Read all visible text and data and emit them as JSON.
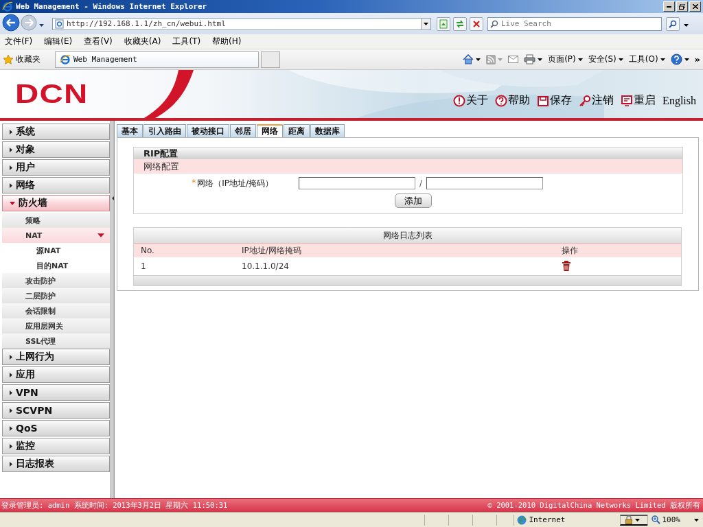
{
  "browser": {
    "title": "Web Management - Windows Internet Explorer",
    "address": "http://192.168.1.1/zh_cn/webui.html",
    "search_placeholder": "Live Search",
    "menu": [
      "文件(F)",
      "编辑(E)",
      "查看(V)",
      "收藏夹(A)",
      "工具(T)",
      "帮助(H)"
    ],
    "favorites_label": "收藏夹",
    "tab_title": "Web Management",
    "commands": [
      {
        "kind": "home"
      },
      {
        "kind": "feed"
      },
      {
        "kind": "mail"
      },
      {
        "kind": "print"
      },
      {
        "kind": "text",
        "label": "页面(P)"
      },
      {
        "kind": "text",
        "label": "安全(S)"
      },
      {
        "kind": "text",
        "label": "工具(O)"
      },
      {
        "kind": "help"
      }
    ],
    "overflow": "»"
  },
  "header": {
    "logo": "DCN",
    "links": [
      {
        "kind": "info",
        "label": "关于"
      },
      {
        "kind": "help",
        "label": "帮助"
      },
      {
        "kind": "save",
        "label": "保存"
      },
      {
        "kind": "logout",
        "label": "注销"
      },
      {
        "kind": "restart",
        "label": "重启"
      },
      {
        "kind": "text",
        "label": "English"
      }
    ]
  },
  "sidebar": {
    "items": [
      {
        "label": "系统",
        "expanded": false
      },
      {
        "label": "对象",
        "expanded": false
      },
      {
        "label": "用户",
        "expanded": false
      },
      {
        "label": "网络",
        "expanded": false
      },
      {
        "label": "防火墙",
        "expanded": true,
        "children": [
          {
            "label": "策略",
            "selected": false
          },
          {
            "label": "NAT",
            "selected": true,
            "expanded": true,
            "children": [
              {
                "label": "源NAT",
                "selected": false
              },
              {
                "label": "目的NAT",
                "selected": false
              }
            ]
          },
          {
            "label": "攻击防护",
            "selected": false
          },
          {
            "label": "二层防护",
            "selected": false
          },
          {
            "label": "会话限制",
            "selected": false
          },
          {
            "label": "应用层网关",
            "selected": false
          },
          {
            "label": "SSL代理",
            "selected": false
          }
        ]
      },
      {
        "label": "上网行为",
        "expanded": false
      },
      {
        "label": "应用",
        "expanded": false
      },
      {
        "label": "VPN",
        "expanded": false
      },
      {
        "label": "SCVPN",
        "expanded": false
      },
      {
        "label": "QoS",
        "expanded": false
      },
      {
        "label": "监控",
        "expanded": false
      },
      {
        "label": "日志报表",
        "expanded": false
      }
    ]
  },
  "tabs": [
    {
      "label": "基本",
      "selected": false
    },
    {
      "label": "引入路由",
      "selected": false
    },
    {
      "label": "被动接口",
      "selected": false
    },
    {
      "label": "邻居",
      "selected": false
    },
    {
      "label": "网络",
      "selected": true
    },
    {
      "label": "距离",
      "selected": false
    },
    {
      "label": "数据库",
      "selected": false
    }
  ],
  "form": {
    "title": "RIP配置",
    "section": "网络配置",
    "required_mark": "*",
    "field_label": "网络（IP地址/掩码）",
    "separator": "/",
    "button": "添加"
  },
  "table": {
    "title": "网络日志列表",
    "columns": [
      "No.",
      "IP地址/网络掩码",
      "操作"
    ],
    "rows": [
      {
        "no": "1",
        "network": "10.1.1.0/24"
      }
    ]
  },
  "footer": {
    "left": "登录管理员: admin 系统时间: 2013年3月2日 星期六 11:50:31",
    "right": "© 2001-2010 DigitalChina Networks Limited 版权所有"
  },
  "status_bar": {
    "zone": "Internet",
    "zoom": "100%"
  }
}
